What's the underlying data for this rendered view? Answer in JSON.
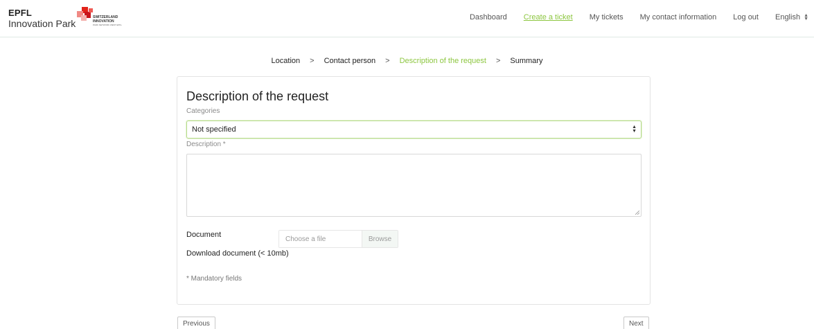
{
  "header": {
    "logo_line1": "EPFL",
    "logo_line2": "Innovation Park",
    "partner_line1": "SWITZERLAND",
    "partner_line2": "INNOVATION",
    "partner_line3": "PARK NETWORK WEST EPFL",
    "nav": [
      {
        "label": "Dashboard",
        "active": false
      },
      {
        "label": "Create a ticket",
        "active": true
      },
      {
        "label": "My tickets",
        "active": false
      },
      {
        "label": "My contact information",
        "active": false
      },
      {
        "label": "Log out",
        "active": false
      }
    ],
    "language": "English"
  },
  "steps": [
    {
      "label": "Location",
      "current": false
    },
    {
      "label": "Contact person",
      "current": false
    },
    {
      "label": "Description of the request",
      "current": true
    },
    {
      "label": "Summary",
      "current": false
    }
  ],
  "steps_separator": ">",
  "form": {
    "title": "Description of the request",
    "categories_label": "Categories",
    "categories_value": "Not specified",
    "description_label": "Description *",
    "description_value": "",
    "document_label": "Document",
    "file_placeholder": "Choose a file",
    "browse_label": "Browse",
    "download_label": "Download document (< 10mb)",
    "mandatory_note": "* Mandatory fields"
  },
  "buttons": {
    "previous": "Previous",
    "next": "Next"
  },
  "colors": {
    "accent": "#8cc63f",
    "swiss_red": "#e2231a"
  }
}
